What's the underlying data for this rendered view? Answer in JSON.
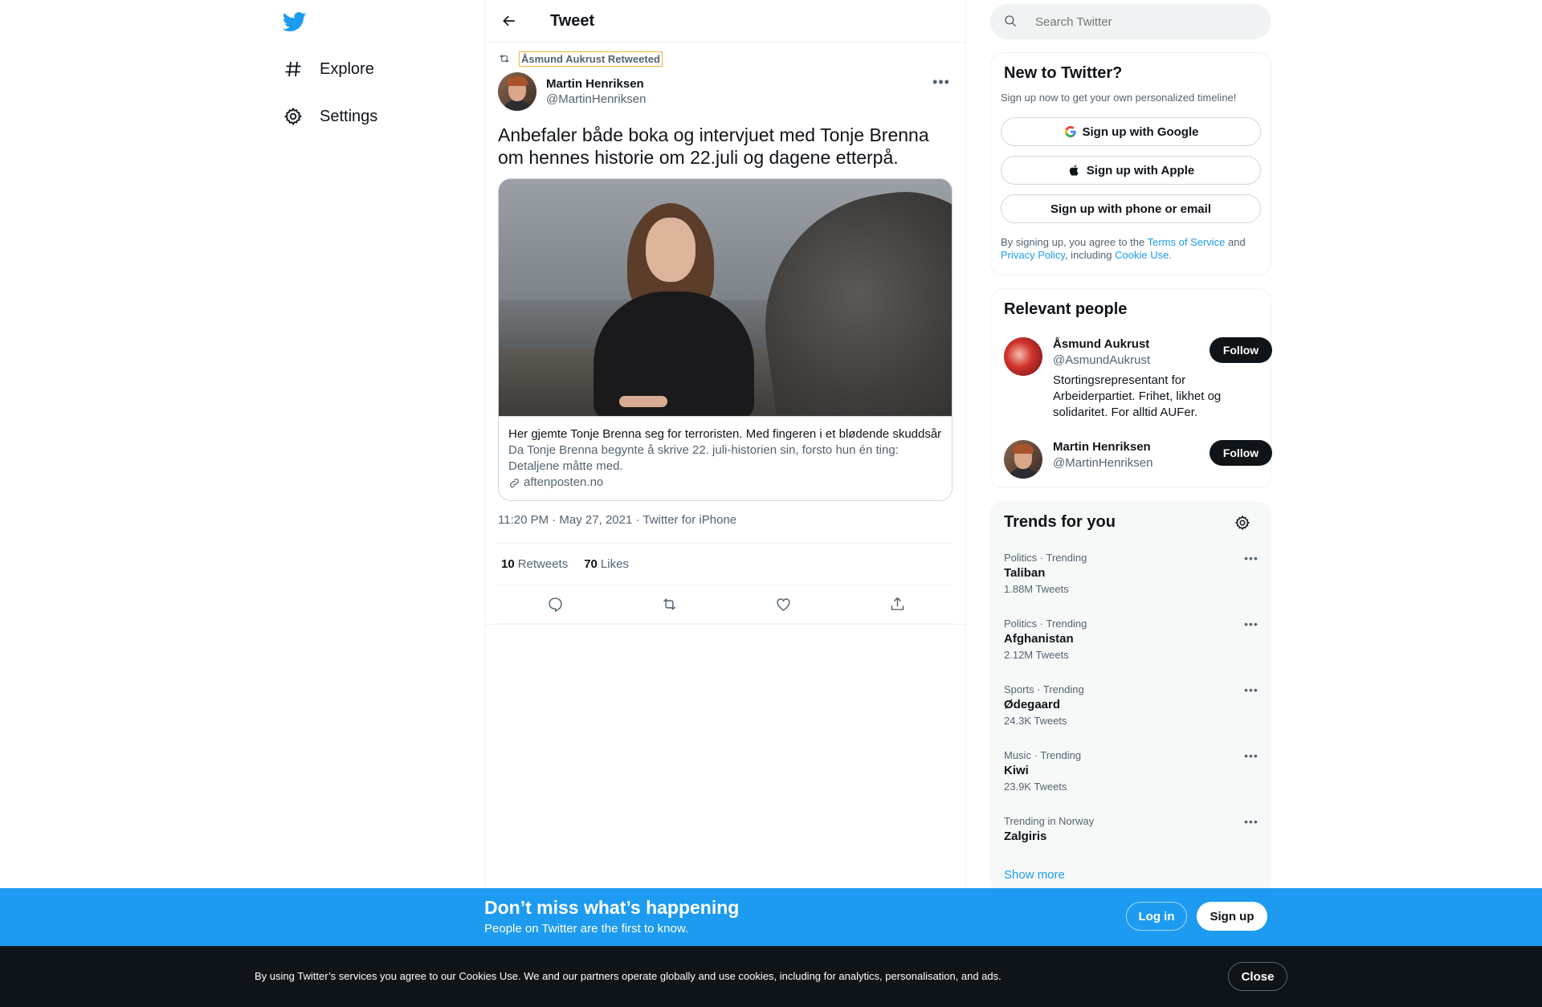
{
  "nav": {
    "logo_icon": "twitter-bird-icon",
    "items": [
      {
        "label": "Explore",
        "icon": "hashtag-icon"
      },
      {
        "label": "Settings",
        "icon": "gear-icon"
      }
    ]
  },
  "header": {
    "title": "Tweet"
  },
  "tweet": {
    "retweeted_by": "Åsmund Aukrust Retweeted",
    "author_name": "Martin Henriksen",
    "author_handle": "@MartinHenriksen",
    "text": "Anbefaler både boka og intervjuet med Tonje Brenna om hennes historie om 22.juli og dagene etterpå.",
    "card": {
      "title": "Her gjemte Tonje Brenna seg for terroristen. Med fingeren i et blødende skuddsår",
      "description": "Da Tonje Brenna begynte å skrive 22. juli-historien sin, forsto hun én ting: Detaljene måtte med.",
      "domain": "aftenposten.no"
    },
    "meta": "11:20 PM · May 27, 2021 · Twitter for iPhone",
    "retweets_count": "10",
    "retweets_label": "Retweets",
    "likes_count": "70",
    "likes_label": "Likes"
  },
  "search": {
    "placeholder": "Search Twitter"
  },
  "signup_panel": {
    "title": "New to Twitter?",
    "subtitle": "Sign up now to get your own personalized timeline!",
    "google": "Sign up with Google",
    "apple": "Sign up with Apple",
    "phone": "Sign up with phone or email",
    "legal_1": "By signing up, you agree to the ",
    "tos": "Terms of Service",
    "legal_2": " and ",
    "privacy": "Privacy Policy",
    "legal_3": ", including ",
    "cookie": "Cookie Use."
  },
  "people_panel": {
    "title": "Relevant people",
    "people": [
      {
        "name": "Åsmund Aukrust",
        "handle": "@AsmundAukrust",
        "bio": "Stortingsrepresentant for Arbeiderpartiet. Frihet, likhet og solidaritet. For alltid AUFer.",
        "follow": "Follow"
      },
      {
        "name": "Martin Henriksen",
        "handle": "@MartinHenriksen",
        "bio": "",
        "follow": "Follow"
      }
    ]
  },
  "trends_panel": {
    "title": "Trends for you",
    "items": [
      {
        "meta": "Politics · Trending",
        "name": "Taliban",
        "count": "1.88M Tweets"
      },
      {
        "meta": "Politics · Trending",
        "name": "Afghanistan",
        "count": "2.12M Tweets"
      },
      {
        "meta": "Sports · Trending",
        "name": "Ødegaard",
        "count": "24.3K Tweets"
      },
      {
        "meta": "Music · Trending",
        "name": "Kiwi",
        "count": "23.9K Tweets"
      },
      {
        "meta": "Trending in Norway",
        "name": "Zalgiris",
        "count": ""
      }
    ],
    "show_more": "Show more"
  },
  "banner": {
    "heading": "Don’t miss what’s happening",
    "sub": "People on Twitter are the first to know.",
    "login": "Log in",
    "signup": "Sign up"
  },
  "cookie_bar": {
    "text": "By using Twitter’s services you agree to our Cookies Use. We and our partners operate globally and use cookies, including for analytics, personalisation, and ads.",
    "close": "Close"
  },
  "colors": {
    "accent": "#1d9bf0",
    "text": "#0f1419",
    "secondary": "#536471",
    "cookie_bg": "#0f1419"
  }
}
